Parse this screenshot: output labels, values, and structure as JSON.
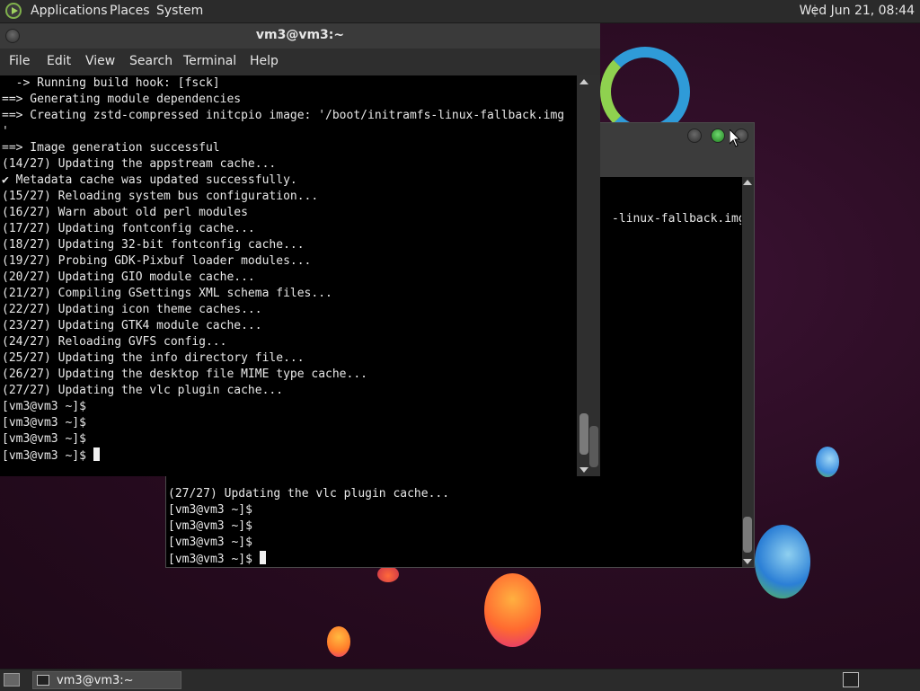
{
  "top_panel": {
    "menus": [
      "Applications",
      "Places",
      "System"
    ],
    "clock": "Wed Jun 21, 08:44"
  },
  "main_window": {
    "title": "vm3@vm3:~",
    "menu": [
      "File",
      "Edit",
      "View",
      "Search",
      "Terminal",
      "Help"
    ],
    "lines": [
      "  -> Running build hook: [fsck]",
      "==> Generating module dependencies",
      "==> Creating zstd-compressed initcpio image: '/boot/initramfs-linux-fallback.img",
      "'",
      "==> Image generation successful",
      "(14/27) Updating the appstream cache...",
      "✔ Metadata cache was updated successfully.",
      "(15/27) Reloading system bus configuration...",
      "(16/27) Warn about old perl modules",
      "(17/27) Updating fontconfig cache...",
      "(18/27) Updating 32-bit fontconfig cache...",
      "(19/27) Probing GDK-Pixbuf loader modules...",
      "(20/27) Updating GIO module cache...",
      "(21/27) Compiling GSettings XML schema files...",
      "(22/27) Updating icon theme caches...",
      "(23/27) Updating GTK4 module cache...",
      "(24/27) Reloading GVFS config...",
      "(25/27) Updating the info directory file...",
      "(26/27) Updating the desktop file MIME type cache...",
      "(27/27) Updating the vlc plugin cache...",
      "[vm3@vm3 ~]$",
      "[vm3@vm3 ~]$",
      "[vm3@vm3 ~]$"
    ],
    "prompt": "[vm3@vm3 ~]$ "
  },
  "back_window": {
    "partial_line": "-linux-fallback.img",
    "lines": [
      "(27/27) Updating the vlc plugin cache...",
      "[vm3@vm3 ~]$",
      "[vm3@vm3 ~]$",
      "[vm3@vm3 ~]$"
    ],
    "prompt": "[vm3@vm3 ~]$ "
  },
  "taskbar": {
    "task_label": "vm3@vm3:~"
  }
}
